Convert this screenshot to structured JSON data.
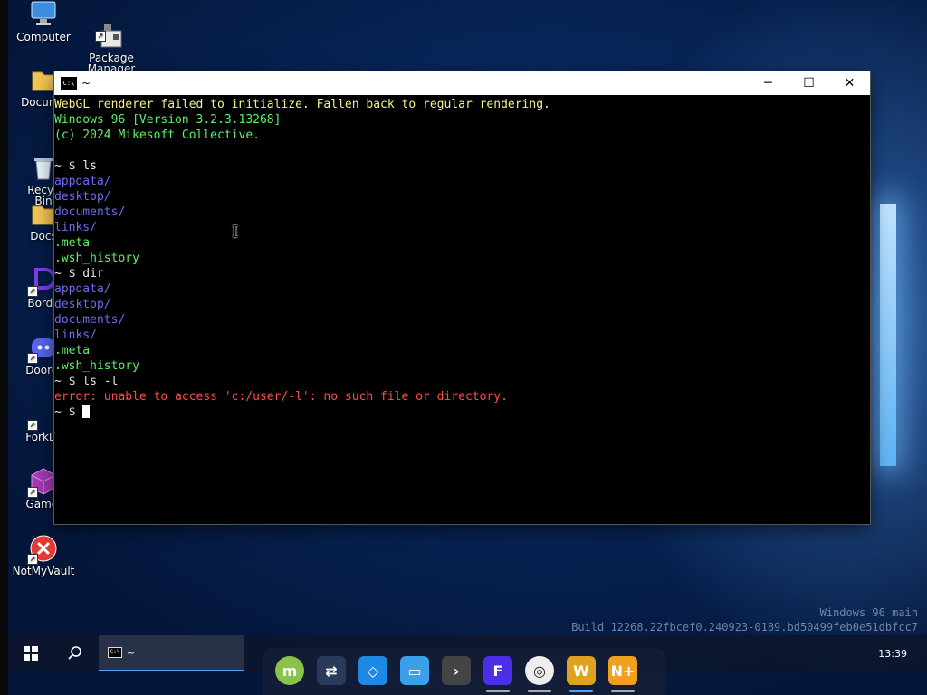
{
  "desktop": {
    "icons": [
      {
        "label": "Computer"
      },
      {
        "label": "Package\nManager"
      },
      {
        "label": "Docume"
      },
      {
        "label": "Recyc\nBin"
      },
      {
        "label": "Docs"
      },
      {
        "label": "Borde"
      },
      {
        "label": "Doordi"
      },
      {
        "label": "ForkLo"
      },
      {
        "label": "Gamei"
      },
      {
        "label": "NotMyVault"
      }
    ],
    "watermark": {
      "line1": "Windows 96 main",
      "line2": "Build 12268.22fbcef0.240923-0189.bd50499feb0e51dbfcc7"
    }
  },
  "terminal": {
    "title": "~",
    "icon_text": "C:\\",
    "buttons": {
      "minimize": "─",
      "maximize": "☐",
      "close": "✕"
    },
    "lines": [
      {
        "text": "WebGL renderer failed to initialize. Fallen back to regular rendering.",
        "color": "yellow"
      },
      {
        "text": "Windows 96 [Version 3.2.3.13268]",
        "color": "green"
      },
      {
        "text": "(c) 2024 Mikesoft Collective.",
        "color": "green"
      },
      {
        "text": "",
        "color": "white"
      },
      {
        "text": "~ $ ls",
        "color": "white"
      },
      {
        "text": "appdata/",
        "color": "blue"
      },
      {
        "text": "desktop/",
        "color": "blue"
      },
      {
        "text": "documents/",
        "color": "blue"
      },
      {
        "text": "links/",
        "color": "blue"
      },
      {
        "text": ".meta",
        "color": "green"
      },
      {
        "text": ".wsh_history",
        "color": "green"
      },
      {
        "text": "~ $ dir",
        "color": "white"
      },
      {
        "text": "appdata/",
        "color": "blue"
      },
      {
        "text": "desktop/",
        "color": "blue"
      },
      {
        "text": "documents/",
        "color": "blue"
      },
      {
        "text": "links/",
        "color": "blue"
      },
      {
        "text": ".meta",
        "color": "green"
      },
      {
        "text": ".wsh_history",
        "color": "green"
      },
      {
        "text": "~ $ ls -l",
        "color": "white"
      },
      {
        "text": "error: unable to access 'c:/user/-l': no such file or directory.",
        "color": "red"
      }
    ],
    "prompt": "~ $ "
  },
  "taskbar": {
    "task_title": "~",
    "task_icon_text": "C:\\",
    "clock": "13:39",
    "dock": [
      {
        "name": "linux-mint",
        "glyph": "m",
        "color": "#8bc34a"
      },
      {
        "name": "settings",
        "glyph": "⇄",
        "color": "#2a3a5a"
      },
      {
        "name": "store",
        "glyph": "◇",
        "color": "#1e88e5"
      },
      {
        "name": "files",
        "glyph": "▭",
        "color": "#3aa0e8"
      },
      {
        "name": "terminal",
        "glyph": "›",
        "color": "#444"
      },
      {
        "name": "fmod",
        "glyph": "F",
        "color": "#4b2ee6"
      },
      {
        "name": "globe",
        "glyph": "◎",
        "color": "#eeeeee"
      },
      {
        "name": "w-app",
        "glyph": "W",
        "color": "#e0a020"
      },
      {
        "name": "notepad-plus",
        "glyph": "N+",
        "color": "#f0a020"
      }
    ]
  }
}
